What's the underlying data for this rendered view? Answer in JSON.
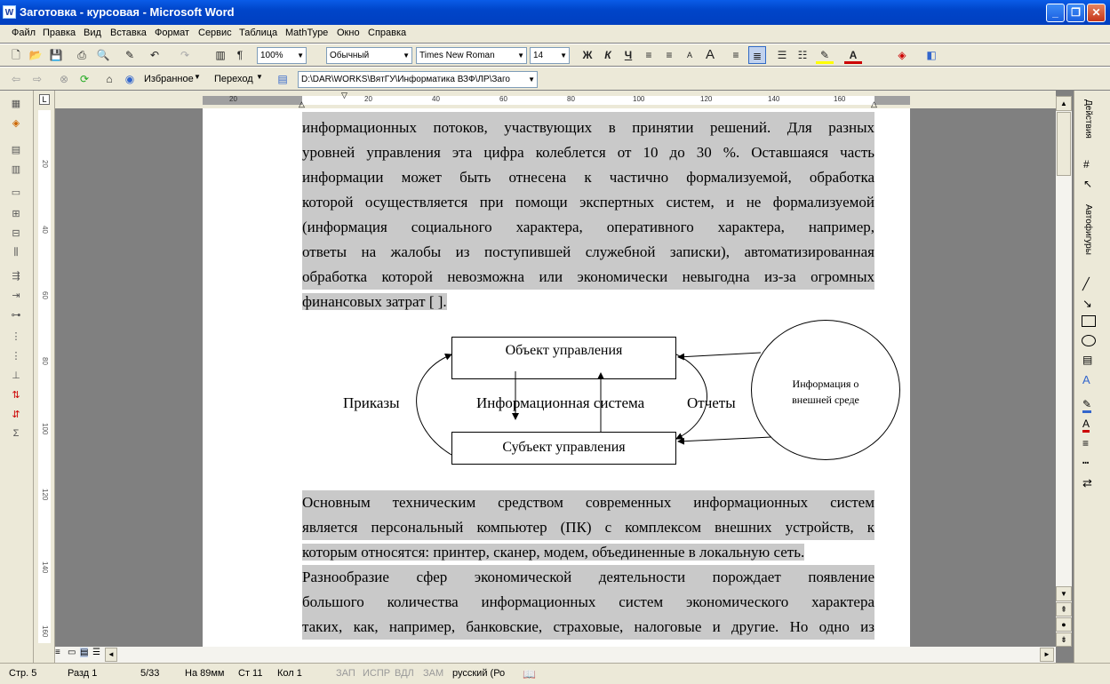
{
  "window": {
    "title": "Заготовка - курсовая - Microsoft Word"
  },
  "menu": [
    "Файл",
    "Правка",
    "Вид",
    "Вставка",
    "Формат",
    "Сервис",
    "Таблица",
    "MathType",
    "Окно",
    "Справка"
  ],
  "toolbar": {
    "zoom": "100%",
    "style": "Обычный",
    "font": "Times New Roman",
    "size": "14",
    "bold": "Ж",
    "italic": "К",
    "underline": "Ч"
  },
  "web_toolbar": {
    "favorites": "Избранное",
    "go": "Переход",
    "address": "D:\\DAR\\WORKS\\ВятГУ\\Информатика ВЗФ\\ЛР\\Заго"
  },
  "ruler": {
    "h_ticks": [
      "20",
      "20",
      "40",
      "60",
      "80",
      "100",
      "120",
      "140",
      "160"
    ],
    "v_ticks": [
      "20",
      "40",
      "60",
      "80",
      "100",
      "120",
      "140",
      "160"
    ]
  },
  "document": {
    "para1_lines": [
      "информационных потоков, участвующих в принятии решений. Для разных",
      "уровней управления эта цифра колеблется от 10 до 30 %. Оставшаяся часть",
      "информации может быть отнесена к частично формализуемой, обработка",
      "которой осуществляется при помощи экспертных систем, и не формализуемой",
      "(информация социального характера, оперативного характера, например,",
      "ответы на жалобы из поступившей служебной записки), автоматизированная",
      "обработка которой невозможна или экономически невыгодна из-за огромных",
      "финансовых затрат [       ]."
    ],
    "diagram": {
      "object": "Объект управления",
      "subject": "Субъект управления",
      "orders": "Приказы",
      "system": "Информационная система",
      "reports": "Отчеты",
      "external": "Информация о внешней среде"
    },
    "para2_lines": [
      "Основным техническим средством современных информационных систем",
      "является персональный компьютер (ПК) с комплексом внешних устройств, к",
      "которым относятся: принтер, сканер, модем, объединенные в локальную сеть."
    ],
    "para3_lines": [
      "Разнообразие сфер экономической деятельности порождает появление",
      "большого количества информационных систем экономического характера",
      "таких, как, например, банковские, страховые, налоговые и другие. Но одно из"
    ]
  },
  "right_panel": {
    "actions": "Действия",
    "autoshapes": "Автофигуры"
  },
  "status": {
    "page": "Стр. 5",
    "section": "Разд 1",
    "pages": "5/33",
    "at": "На 89мм",
    "line": "Ст 11",
    "col": "Кол 1",
    "rec": "ЗАП",
    "trk": "ИСПР",
    "ext": "ВДЛ",
    "ovr": "ЗАМ",
    "lang": "русский (Ро"
  }
}
